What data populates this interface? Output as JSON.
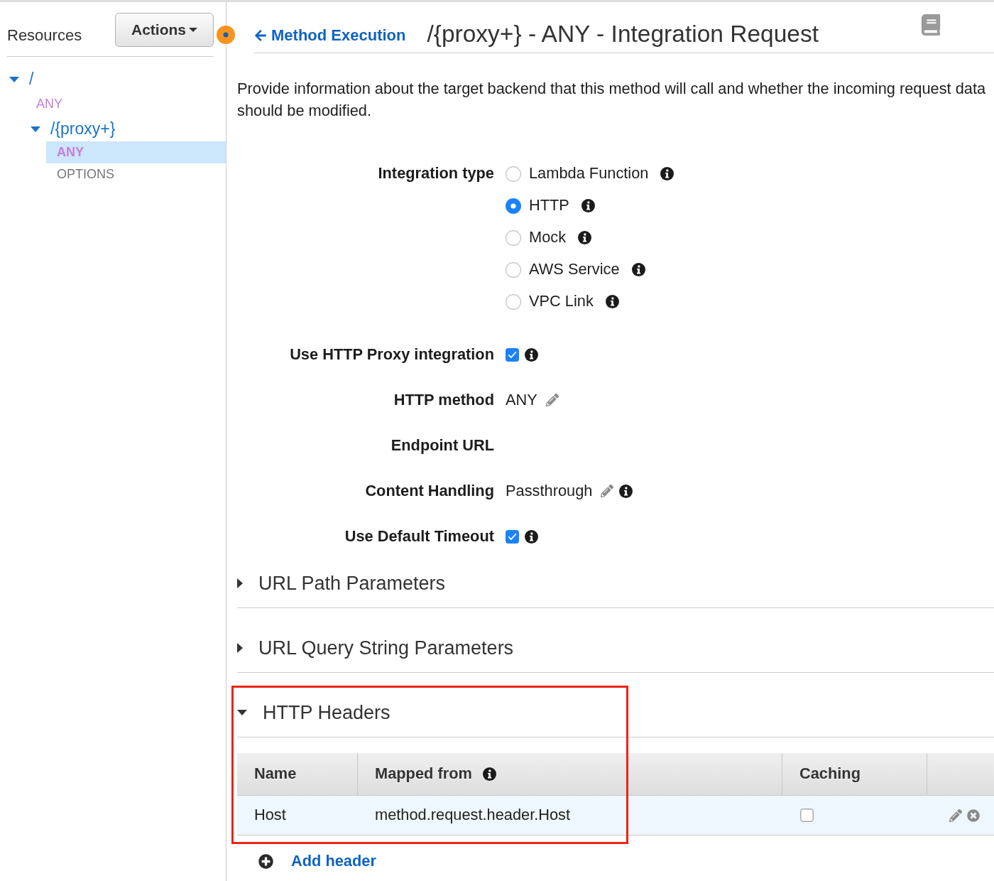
{
  "sidebar": {
    "title": "Resources",
    "actions_button": "Actions",
    "tree": [
      {
        "kind": "resource",
        "label": "/",
        "expanded": true,
        "selected": false,
        "children": [
          {
            "kind": "method",
            "label": "ANY",
            "color": "#c77ed8",
            "selected": false
          },
          {
            "kind": "resource",
            "label": "/{proxy+}",
            "expanded": true,
            "selected": false,
            "children": [
              {
                "kind": "method",
                "label": "ANY",
                "color": "#c77ed8",
                "selected": true
              },
              {
                "kind": "method",
                "label": "OPTIONS",
                "color": "#777777",
                "selected": false
              }
            ]
          }
        ]
      }
    ]
  },
  "header": {
    "back_link": "Method Execution",
    "title": "/{proxy+} - ANY - Integration Request"
  },
  "description": "Provide information about the target backend that this method will call and whether the incoming request data should be modified.",
  "integration_type": {
    "label": "Integration type",
    "options": [
      {
        "label": "Lambda Function",
        "selected": false
      },
      {
        "label": "HTTP",
        "selected": true
      },
      {
        "label": "Mock",
        "selected": false
      },
      {
        "label": "AWS Service",
        "selected": false
      },
      {
        "label": "VPC Link",
        "selected": false
      }
    ]
  },
  "fields": [
    {
      "kind": "checkbox",
      "label": "Use HTTP Proxy integration",
      "checked": true,
      "info": true
    },
    {
      "kind": "editable",
      "label": "HTTP method",
      "value": "ANY",
      "info": false
    },
    {
      "kind": "blank",
      "label": "Endpoint URL"
    },
    {
      "kind": "editable",
      "label": "Content Handling",
      "value": "Passthrough",
      "info": true
    },
    {
      "kind": "checkbox",
      "label": "Use Default Timeout",
      "checked": true,
      "info": true
    }
  ],
  "sections": [
    {
      "title": "URL Path Parameters",
      "expanded": false,
      "highlighted": false
    },
    {
      "title": "URL Query String Parameters",
      "expanded": false,
      "highlighted": false
    },
    {
      "title": "HTTP Headers",
      "expanded": true,
      "highlighted": true,
      "table": {
        "columns": [
          {
            "label": "Name",
            "info": false
          },
          {
            "label": "Mapped from",
            "info": true
          },
          {
            "label": "Caching",
            "info": false
          }
        ],
        "rows": [
          {
            "name": "Host",
            "mapped_from": "method.request.header.Host",
            "caching": false
          }
        ]
      },
      "add_link": "Add header"
    }
  ]
}
